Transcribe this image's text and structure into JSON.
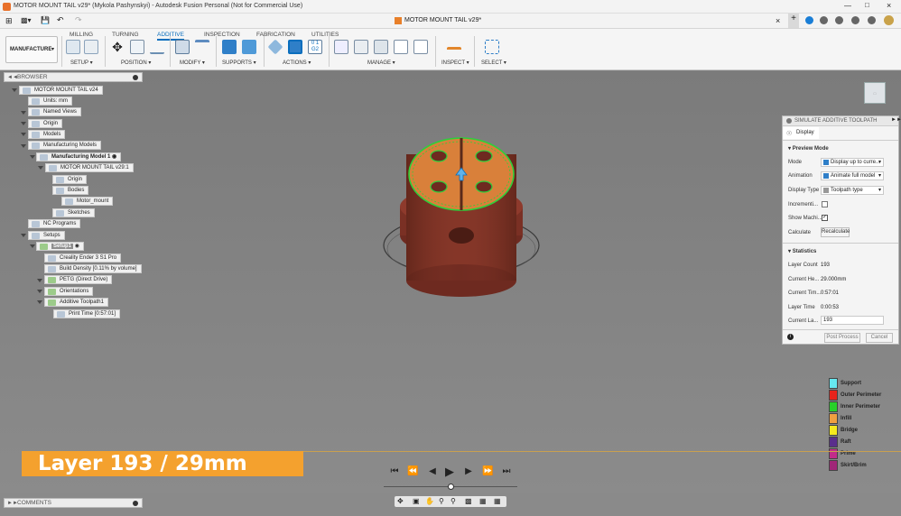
{
  "window": {
    "title": "MOTOR MOUNT TAIL v29* (Mykola Pashynskyi) - Autodesk Fusion Personal (Not for Commercial Use)",
    "tab_title": "MOTOR MOUNT TAIL v29*"
  },
  "ribbon": {
    "tabs": [
      "MILLING",
      "TURNING",
      "ADDITIVE",
      "INSPECTION",
      "FABRICATION",
      "UTILITIES"
    ],
    "active_tab": "ADDITIVE",
    "workspace": "MANUFACTURE",
    "groups": [
      "SETUP",
      "POSITION",
      "MODIFY",
      "SUPPORTS",
      "ACTIONS",
      "MANAGE",
      "INSPECT",
      "SELECT"
    ]
  },
  "browser": {
    "header": "BROWSER",
    "nodes": {
      "root": "MOTOR MOUNT TAIL v24",
      "units": "Units: mm",
      "named_views": "Named Views",
      "origin": "Origin",
      "models": "Models",
      "mfg_models": "Manufacturing Models",
      "mfg_model1": "Manufacturing Model 1",
      "mmt": "MOTOR MOUNT TAIL v29:1",
      "origin2": "Origin",
      "bodies": "Bodies",
      "motor_mount": "Motor_mount",
      "sketches": "Sketches",
      "nc_programs": "NC Programs",
      "setups": "Setups",
      "setup1": "Setup1",
      "printer": "Creality Ender 3 S1 Pro",
      "build_density": "Build Density [0.11% by volume]",
      "material": "PETG (Direct Drive)",
      "orientations": "Orientations",
      "toolpath": "Additive Toolpath1",
      "print_time": "Print Time [0:57:01]"
    }
  },
  "simulate": {
    "title": "SIMULATE ADDITIVE TOOLPATH",
    "display_tab": "Display",
    "preview_mode": "Preview Mode",
    "mode_label": "Mode",
    "mode_value": "Display up to curre...",
    "animation_label": "Animation",
    "animation_value": "Animate full model",
    "display_type_label": "Display Type",
    "display_type_value": "Toolpath type",
    "incremental_label": "Incrementi...",
    "show_machine_label": "Show Machi...",
    "calculate_label": "Calculate",
    "recalculate": "Recalculate",
    "statistics": "Statistics",
    "layer_count_label": "Layer Count",
    "layer_count": "193",
    "current_height_label": "Current He...",
    "current_height": "29.000mm",
    "current_time_label": "Current Tim...",
    "current_time": "0:57:01",
    "layer_time_label": "Layer Time",
    "layer_time": "0:00:53",
    "current_layer_label": "Current La...",
    "current_layer": "193",
    "post_process": "Post Process",
    "cancel": "Cancel"
  },
  "legend": [
    {
      "label": "Support",
      "color": "#66e8f0"
    },
    {
      "label": "Outer Perimeter",
      "color": "#e8241c"
    },
    {
      "label": "Inner Perimeter",
      "color": "#28d02a"
    },
    {
      "label": "Infill",
      "color": "#f0a040"
    },
    {
      "label": "Bridge",
      "color": "#f6ea1e"
    },
    {
      "label": "Raft",
      "color": "#5a2e8c"
    },
    {
      "label": "Prime",
      "color": "#c22c8a"
    },
    {
      "label": "Skirt/Brim",
      "color": "#a02678"
    }
  ],
  "layer_banner": "Layer 193 / 29mm",
  "comments_label": "COMMENTS",
  "colors": {
    "accent": "#0a6ebd",
    "banner": "#f4a12e",
    "body": "#8a3a2c"
  }
}
